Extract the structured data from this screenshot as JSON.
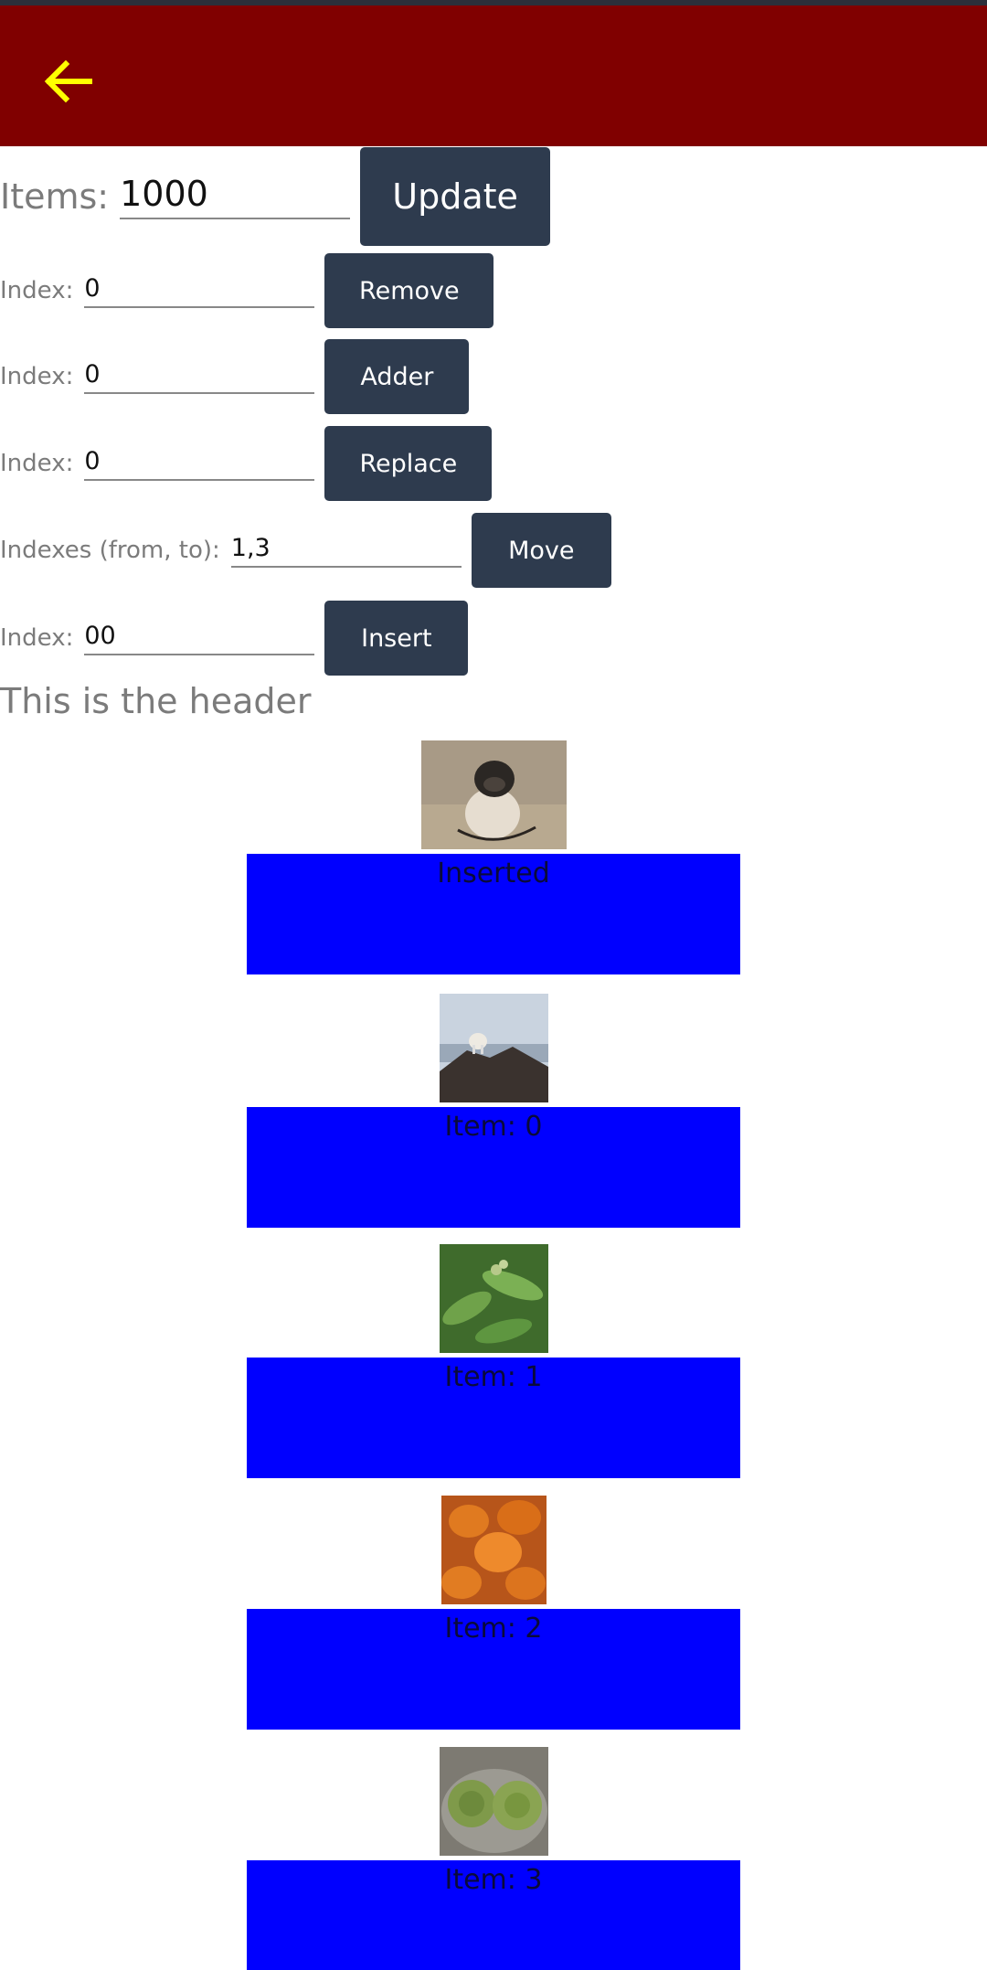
{
  "app_bar": {
    "back_icon": "arrow-left-icon",
    "background": "#800000",
    "icon_color": "#ffff00"
  },
  "controls": {
    "items": {
      "label": "Items:",
      "value": "1000",
      "button": "Update"
    },
    "remove": {
      "label": "Index:",
      "value": "0",
      "button": "Remove"
    },
    "adder": {
      "label": "Index:",
      "value": "0",
      "button": "Adder"
    },
    "replace": {
      "label": "Index:",
      "value": "0",
      "button": "Replace"
    },
    "move": {
      "label": "Indexes (from, to):",
      "value": "1,3",
      "button": "Move"
    },
    "insert": {
      "label": "Index:",
      "value": "00",
      "button": "Insert"
    }
  },
  "list": {
    "header": "This is the header",
    "items": [
      {
        "label": "Inserted",
        "image": "pug-dog-photo"
      },
      {
        "label": "Item: 0",
        "image": "mountain-goat-photo"
      },
      {
        "label": "Item: 1",
        "image": "green-plant-photo"
      },
      {
        "label": "Item: 2",
        "image": "pumpkins-photo"
      },
      {
        "label": "Item: 3",
        "image": "artichokes-photo"
      }
    ]
  },
  "colors": {
    "button": "#2e3b4e",
    "item_box": "#0000ff"
  }
}
